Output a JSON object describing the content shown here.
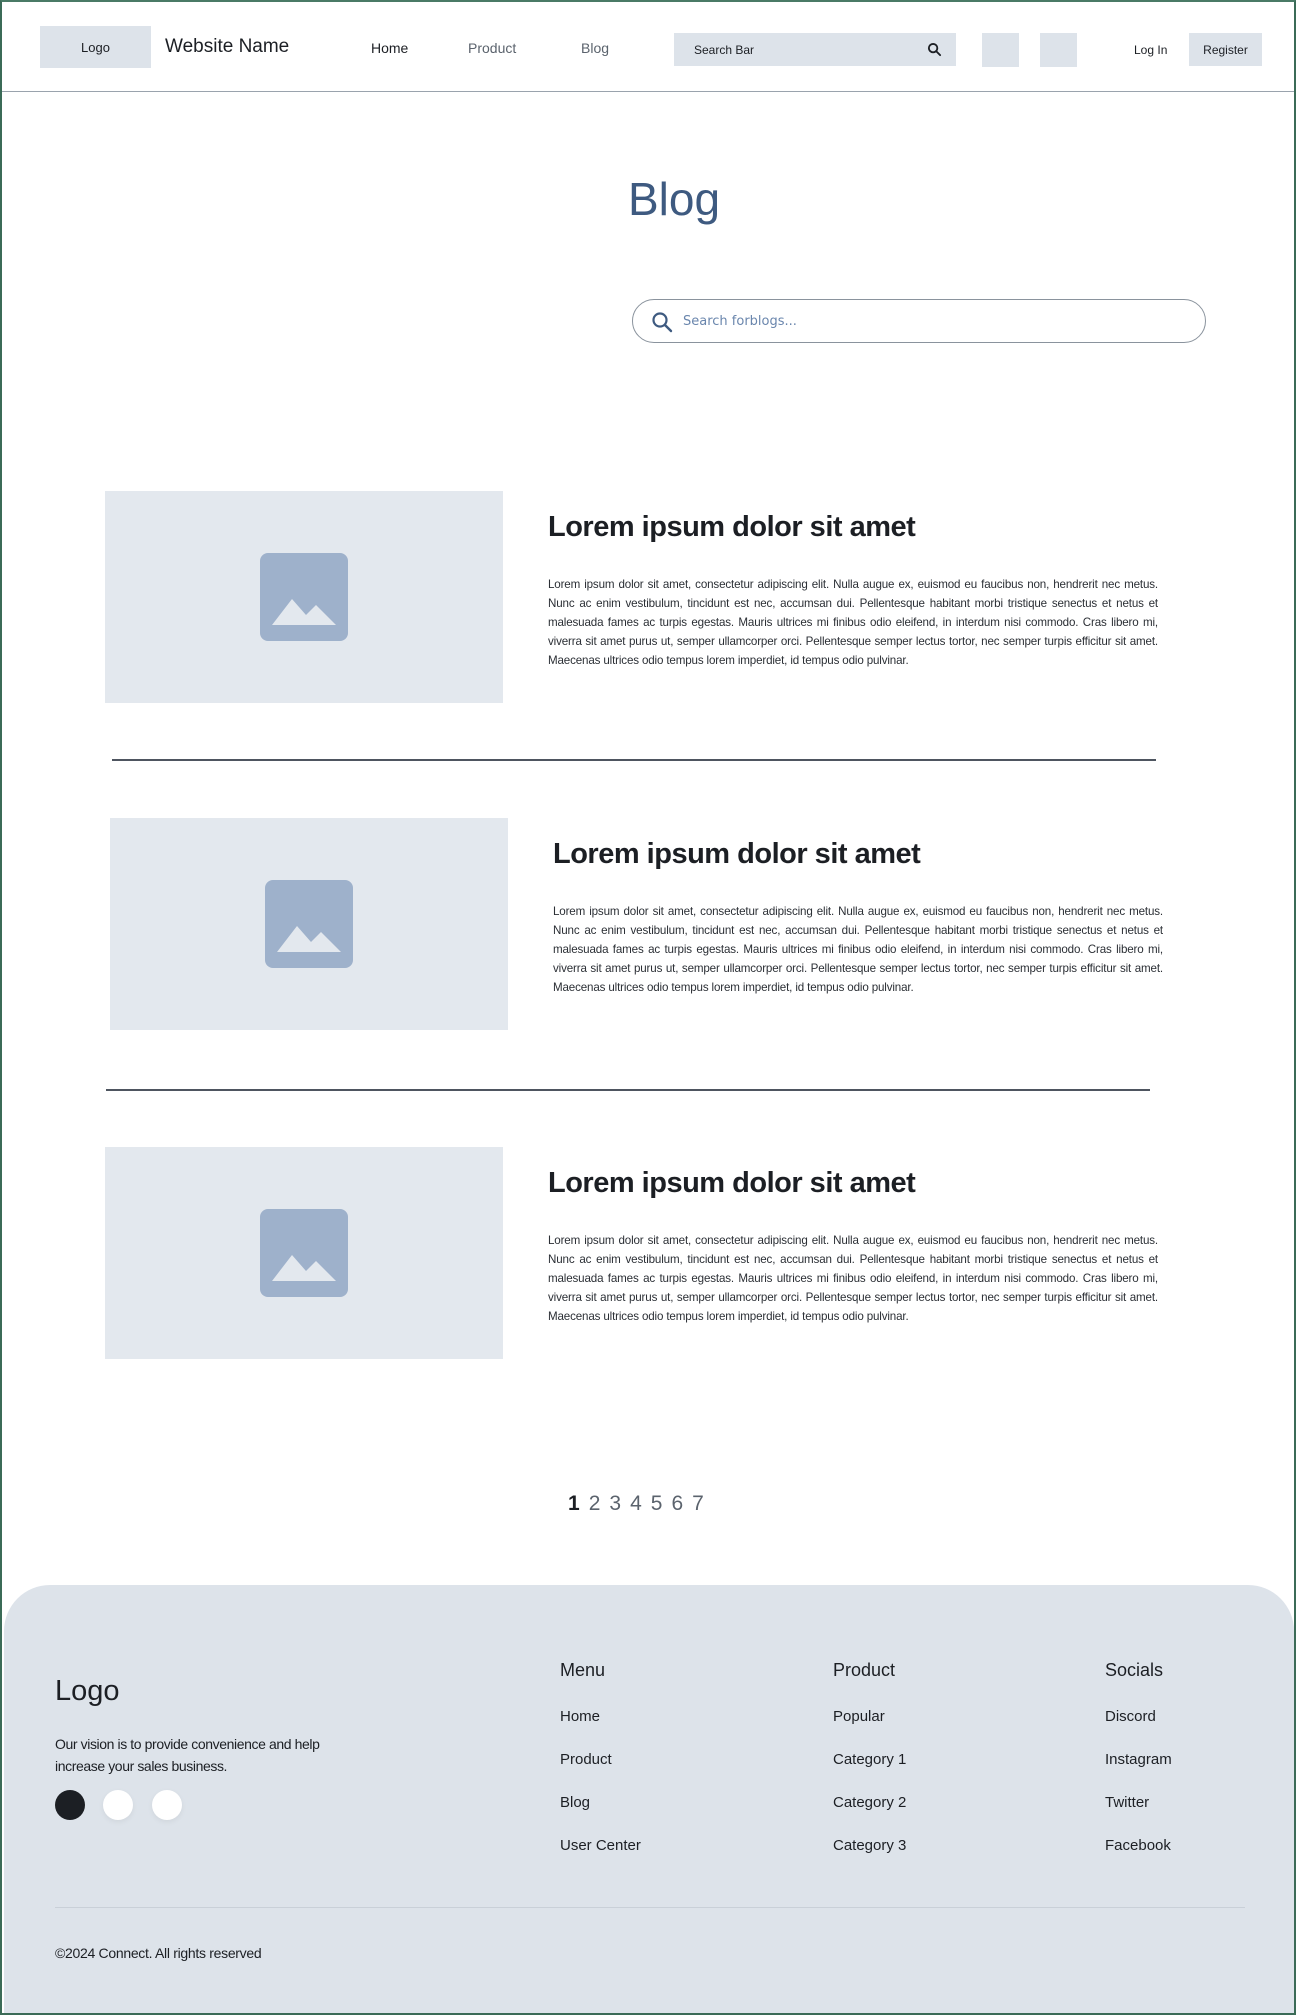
{
  "header": {
    "logo": "Logo",
    "site_name": "Website Name",
    "nav": {
      "home": "Home",
      "product": "Product",
      "blog": "Blog"
    },
    "search_label": "Search Bar",
    "login": "Log In",
    "register": "Register"
  },
  "page": {
    "title": "Blog",
    "search_placeholder": "Search forblogs..."
  },
  "posts": [
    {
      "title": "Lorem ipsum dolor sit amet",
      "excerpt": "Lorem ipsum dolor sit amet, consectetur adipiscing elit. Nulla augue ex, euismod eu faucibus non, hendrerit nec metus. Nunc ac enim vestibulum, tincidunt est nec, accumsan dui. Pellentesque habitant morbi tristique senectus et netus et malesuada fames ac turpis egestas. Mauris ultrices mi finibus odio eleifend, in interdum nisi commodo. Cras libero mi, viverra sit amet purus ut, semper ullamcorper orci. Pellentesque semper lectus tortor, nec semper turpis efficitur sit amet. Maecenas ultrices odio tempus lorem imperdiet, id tempus odio pulvinar."
    },
    {
      "title": "Lorem ipsum dolor sit amet",
      "excerpt": "Lorem ipsum dolor sit amet, consectetur adipiscing elit. Nulla augue ex, euismod eu faucibus non, hendrerit nec metus. Nunc ac enim vestibulum, tincidunt est nec, accumsan dui. Pellentesque habitant morbi tristique senectus et netus et malesuada fames ac turpis egestas. Mauris ultrices mi finibus odio eleifend, in interdum nisi commodo. Cras libero mi, viverra sit amet purus ut, semper ullamcorper orci. Pellentesque semper lectus tortor, nec semper turpis efficitur sit amet. Maecenas ultrices odio tempus lorem imperdiet, id tempus odio pulvinar."
    },
    {
      "title": "Lorem ipsum dolor sit amet",
      "excerpt": "Lorem ipsum dolor sit amet, consectetur adipiscing elit. Nulla augue ex, euismod eu faucibus non, hendrerit nec metus. Nunc ac enim vestibulum, tincidunt est nec, accumsan dui. Pellentesque habitant morbi tristique senectus et netus et malesuada fames ac turpis egestas. Mauris ultrices mi finibus odio eleifend, in interdum nisi commodo. Cras libero mi, viverra sit amet purus ut, semper ullamcorper orci. Pellentesque semper lectus tortor, nec semper turpis efficitur sit amet. Maecenas ultrices odio tempus lorem imperdiet, id tempus odio pulvinar."
    }
  ],
  "pagination": {
    "current": "1",
    "pages": [
      "1",
      "2",
      "3",
      "4",
      "5",
      "6",
      "7"
    ]
  },
  "footer": {
    "logo": "Logo",
    "tagline": "Our vision is to provide convenience and help increase your sales business.",
    "menu": {
      "heading": "Menu",
      "links": [
        "Home",
        "Product",
        "Blog",
        "User Center"
      ]
    },
    "product": {
      "heading": "Product",
      "links": [
        "Popular",
        "Category 1",
        "Category 2",
        "Category 3"
      ]
    },
    "socials": {
      "heading": "Socials",
      "links": [
        "Discord",
        "Instagram",
        "Twitter",
        "Facebook"
      ]
    },
    "copyright": "©2024 Connect. All rights reserved"
  },
  "colors": {
    "title": "#3e5a80",
    "placeholder_box": "#dde3ea",
    "image_icon": "#9eb1cb",
    "footer_bg": "#dde3ea",
    "text": "#1c1f24"
  },
  "icons": {
    "search": "search-icon",
    "image_placeholder": "image-icon",
    "social_dots": [
      "social-dot-icon",
      "social-dot-icon",
      "social-dot-icon"
    ]
  }
}
